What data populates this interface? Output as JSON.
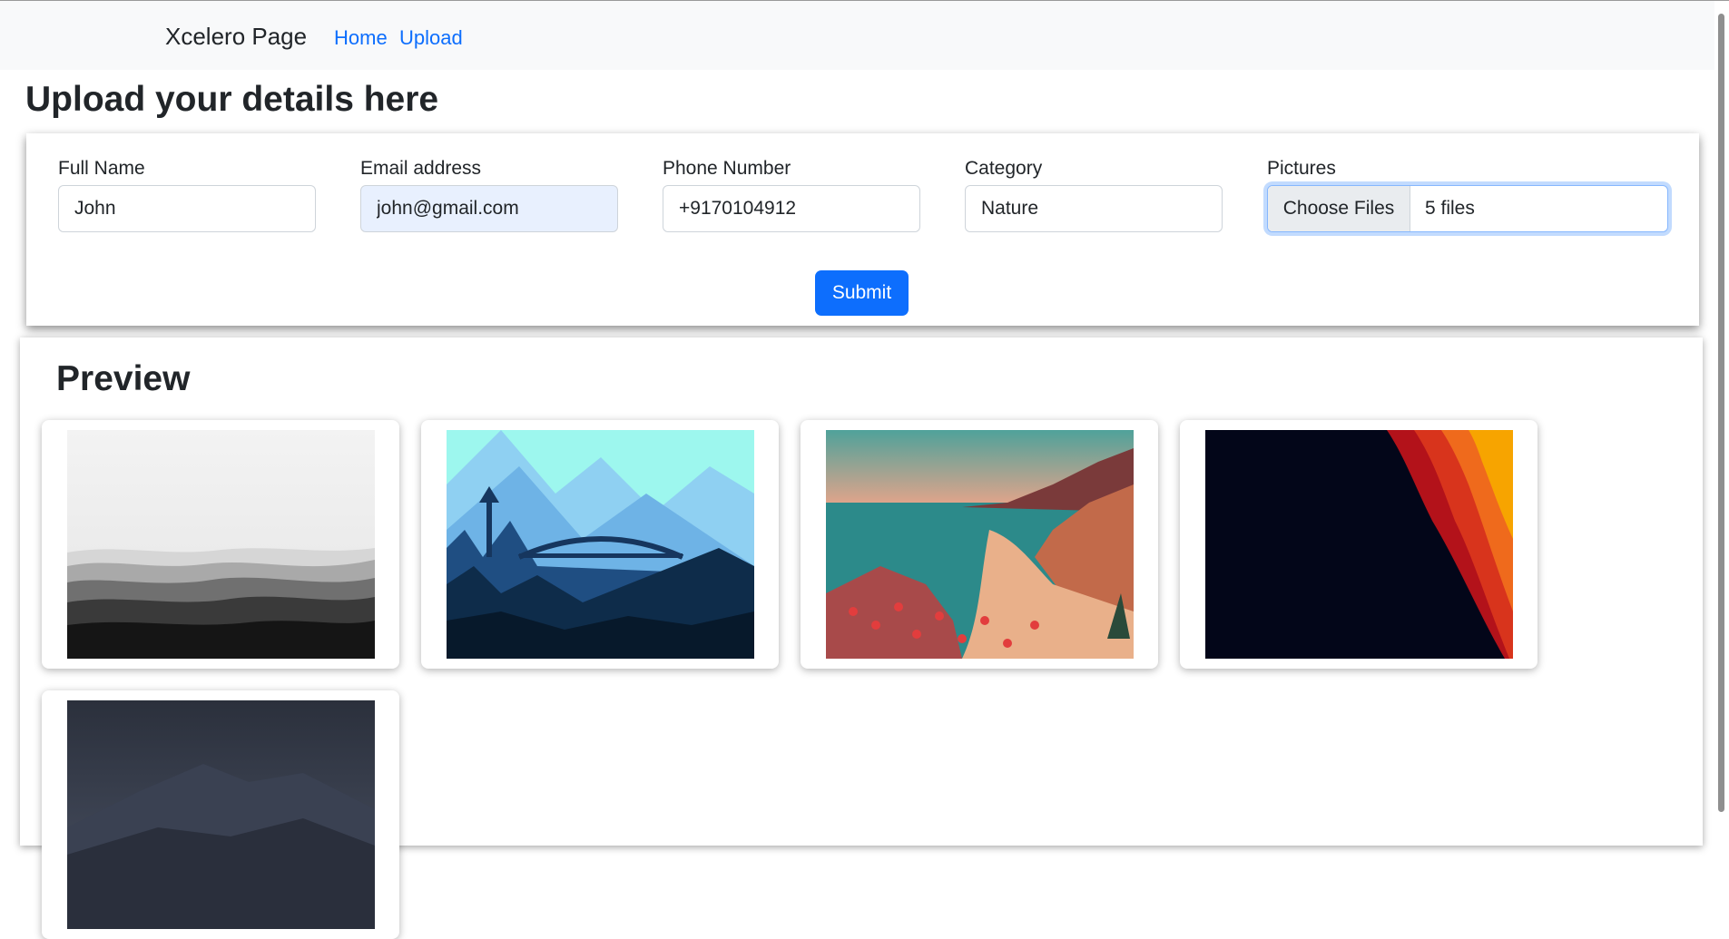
{
  "navbar": {
    "brand": "Xcelero Page",
    "links": [
      {
        "label": "Home"
      },
      {
        "label": "Upload"
      }
    ]
  },
  "page_title": "Upload your details here",
  "form": {
    "full_name": {
      "label": "Full Name",
      "value": "John"
    },
    "email": {
      "label": "Email address",
      "value": "john@gmail.com"
    },
    "phone": {
      "label": "Phone Number",
      "value": "+9170104912"
    },
    "category": {
      "label": "Category",
      "value": "Nature"
    },
    "pictures": {
      "label": "Pictures",
      "button": "Choose Files",
      "status": "5 files"
    },
    "submit_label": "Submit"
  },
  "preview": {
    "title": "Preview",
    "images": [
      {
        "name": "grayscale-mountains-image"
      },
      {
        "name": "blue-bridge-forest-image"
      },
      {
        "name": "coastal-sunset-flowers-image"
      },
      {
        "name": "dark-lava-layers-image"
      },
      {
        "name": "dusk-mountain-image"
      }
    ]
  },
  "colors": {
    "primary": "#0d6efd",
    "navbar_bg": "#f8f9fa",
    "text": "#212529",
    "autofill_bg": "#e8f0fe"
  }
}
